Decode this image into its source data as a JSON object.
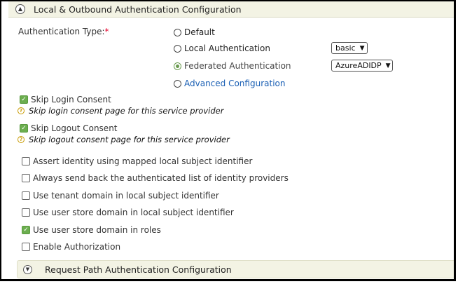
{
  "section": {
    "title": "Local & Outbound Authentication Configuration",
    "collapse_icon": "chevron-up-icon"
  },
  "auth_type": {
    "label": "Authentication Type:",
    "required_mark": "*",
    "options": [
      {
        "label": "Default",
        "selected": false
      },
      {
        "label": "Local Authentication",
        "selected": false
      },
      {
        "label": "Federated Authentication",
        "selected": true
      },
      {
        "label": "Advanced Configuration",
        "selected": false
      }
    ],
    "local_select": "basic",
    "federated_select": "AzureADIDP"
  },
  "consent": {
    "skip_login": {
      "label": "Skip Login Consent",
      "checked": true,
      "help": "Skip login consent page for this service provider"
    },
    "skip_logout": {
      "label": "Skip Logout Consent",
      "checked": true,
      "help": "Skip logout consent page for this service provider"
    }
  },
  "options": [
    {
      "label": "Assert identity using mapped local subject identifier",
      "checked": false
    },
    {
      "label": "Always send back the authenticated list of identity providers",
      "checked": false
    },
    {
      "label": "Use tenant domain in local subject identifier",
      "checked": false
    },
    {
      "label": "Use user store domain in local subject identifier",
      "checked": false
    },
    {
      "label": "Use user store domain in roles",
      "checked": true
    },
    {
      "label": "Enable Authorization",
      "checked": false
    }
  ],
  "request_path": {
    "title": "Request Path Authentication Configuration",
    "expand_icon": "chevron-down-icon"
  },
  "colors": {
    "accent_green": "#6cae4f",
    "link_blue": "#1a5fb4",
    "required_red": "#e4002b",
    "header_bg": "#f3f3e4"
  }
}
